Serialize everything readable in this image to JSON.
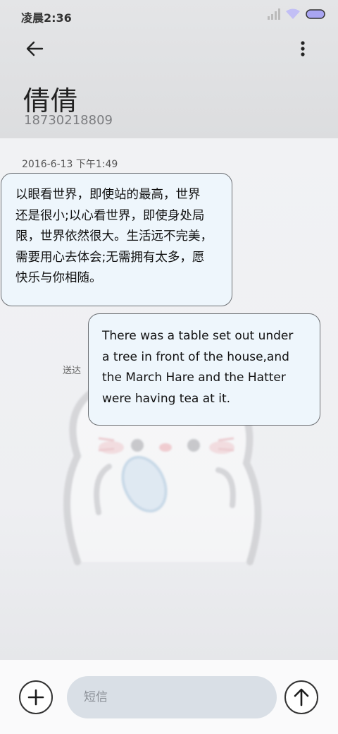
{
  "status_bar": {
    "time": "凌晨2:36",
    "icons": [
      "signal-icon",
      "wifi-icon",
      "battery-icon"
    ]
  },
  "header": {
    "back_icon": "back-arrow-icon",
    "menu_icon": "more-vertical-icon",
    "contact_name": "倩倩",
    "contact_number": "18730218809"
  },
  "conversation": {
    "timestamp": "2016-6-13 下午1:49",
    "incoming_message": {
      "lines": [
        "以眼看世界，即使站的最高，世界",
        "还是很小;以心看世界，即使身处局",
        "限，世界依然很大。生活远不完美，",
        "需要用心去体会;无需拥有太多，愿",
        "快乐与你相随。"
      ]
    },
    "outgoing_message": {
      "lines": [
        "There was a table set out under",
        "a tree in front of the house,and",
        "the March Hare and the Hatter",
        "were having tea at it."
      ],
      "status": "送达"
    }
  },
  "composer": {
    "add_icon": "plus-icon",
    "placeholder": "短信",
    "value": "",
    "send_icon": "send-arrow-icon"
  },
  "colors": {
    "bubble_background": "#eef6fc",
    "bubble_border": "#6e7175",
    "input_background": "#d9dfe6",
    "header_background": "#e0e1e3",
    "battery_fill": "#a9a5f2"
  }
}
